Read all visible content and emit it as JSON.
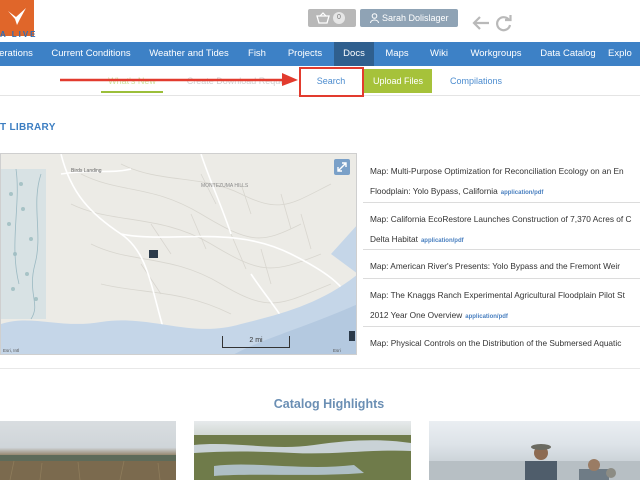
{
  "header": {
    "logo_text": "A LIVE",
    "cart_count": "0",
    "user_name": "Sarah Dolislager"
  },
  "main_nav": {
    "items": [
      {
        "label": "erations"
      },
      {
        "label": "Current Conditions"
      },
      {
        "label": "Weather and Tides"
      },
      {
        "label": "Fish"
      },
      {
        "label": "Projects"
      },
      {
        "label": "Docs"
      },
      {
        "label": "Maps"
      },
      {
        "label": "Wiki"
      },
      {
        "label": "Workgroups"
      },
      {
        "label": "Data Catalog"
      },
      {
        "label": "Explo"
      }
    ],
    "active_index": 5
  },
  "sub_nav": {
    "whats_new": "What's New",
    "create_download": "Create Download Reque",
    "search": "Search",
    "upload_files": "Upload Files",
    "compilations": "Compilations"
  },
  "section_title": "T LIBRARY",
  "map": {
    "place_montezuma": "MONTEZUMA HILLS",
    "place_birds": "Birds Landing",
    "scale_label": "2 mi",
    "attribution_left": "Esri, Intl",
    "attribution_right": "Esri"
  },
  "documents": [
    {
      "line1": "Map: Multi-Purpose Optimization for Reconciliation Ecology on an En",
      "line2": "Floodplain: Yolo Bypass, California",
      "mime": "application/pdf"
    },
    {
      "line1": "Map: California EcoRestore Launches Construction of 7,370 Acres of C",
      "line2": "Delta Habitat",
      "mime": "application/pdf"
    },
    {
      "line1": "Map: American River's Presents: Yolo Bypass and the Fremont Weir",
      "line2": "",
      "mime": ""
    },
    {
      "line1": "Map: The Knaggs Ranch Experimental Agricultural Floodplain Pilot St",
      "line2": "2012 Year One Overview",
      "mime": "application/pdf"
    },
    {
      "line1": "Map: Physical Controls on the Distribution of the Submersed Aquatic",
      "line2": "",
      "mime": ""
    }
  ],
  "catalog": {
    "title": "Catalog Highlights"
  },
  "colors": {
    "nav_blue": "#3d81c6",
    "nav_active": "#2f5f8e",
    "upload_green": "#a6c23a",
    "highlight_red": "#e23b2e",
    "logo_orange": "#e0662a"
  }
}
